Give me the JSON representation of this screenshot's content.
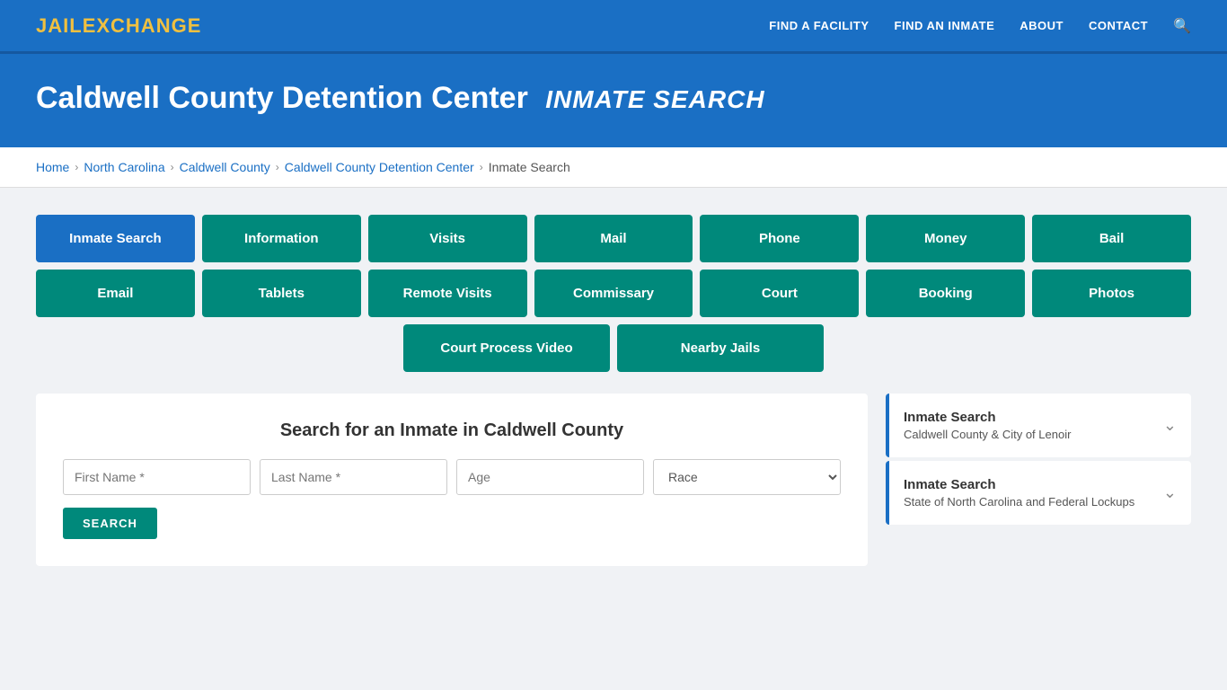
{
  "header": {
    "logo_jail": "JAIL",
    "logo_exchange": "EXCHANGE",
    "nav": [
      {
        "label": "FIND A FACILITY"
      },
      {
        "label": "FIND AN INMATE"
      },
      {
        "label": "ABOUT"
      },
      {
        "label": "CONTACT"
      }
    ]
  },
  "hero": {
    "title": "Caldwell County Detention Center",
    "subtitle": "INMATE SEARCH"
  },
  "breadcrumb": {
    "items": [
      {
        "label": "Home"
      },
      {
        "label": "North Carolina"
      },
      {
        "label": "Caldwell County"
      },
      {
        "label": "Caldwell County Detention Center"
      },
      {
        "label": "Inmate Search"
      }
    ]
  },
  "nav_buttons": {
    "row1": [
      {
        "label": "Inmate Search",
        "active": true
      },
      {
        "label": "Information",
        "active": false
      },
      {
        "label": "Visits",
        "active": false
      },
      {
        "label": "Mail",
        "active": false
      },
      {
        "label": "Phone",
        "active": false
      },
      {
        "label": "Money",
        "active": false
      },
      {
        "label": "Bail",
        "active": false
      }
    ],
    "row2": [
      {
        "label": "Email",
        "active": false
      },
      {
        "label": "Tablets",
        "active": false
      },
      {
        "label": "Remote Visits",
        "active": false
      },
      {
        "label": "Commissary",
        "active": false
      },
      {
        "label": "Court",
        "active": false
      },
      {
        "label": "Booking",
        "active": false
      },
      {
        "label": "Photos",
        "active": false
      }
    ],
    "row3": [
      {
        "label": "Court Process Video",
        "active": false
      },
      {
        "label": "Nearby Jails",
        "active": false
      }
    ]
  },
  "search": {
    "title": "Search for an Inmate in Caldwell County",
    "first_name_placeholder": "First Name *",
    "last_name_placeholder": "Last Name *",
    "age_placeholder": "Age",
    "race_placeholder": "Race",
    "button_label": "SEARCH"
  },
  "sidebar": {
    "items": [
      {
        "title": "Inmate Search",
        "subtitle": "Caldwell County & City of Lenoir"
      },
      {
        "title": "Inmate Search",
        "subtitle": "State of North Carolina and Federal Lockups"
      }
    ]
  }
}
